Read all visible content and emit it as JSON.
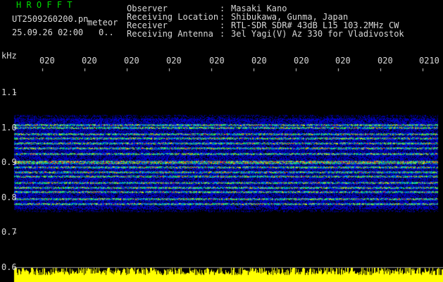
{
  "header": {
    "logo": "H R O F F T",
    "filename": "UT2509260200.pn",
    "meteor_label": "meteor",
    "date": "25.09.26 02:00",
    "count": "0.."
  },
  "info": [
    {
      "label": "Observer",
      "value": "Masaki Kano"
    },
    {
      "label": "Receiving Location",
      "value": "Shibukawa, Gunma, Japan"
    },
    {
      "label": "Receiver",
      "value": "RTL-SDR SDR# 43dB L15 103.2MHz CW"
    },
    {
      "label": "Receiving Antenna",
      "value": "3el Yagi(V) Az 330 for Vladivostok"
    }
  ],
  "axis": {
    "y_unit": "kHz",
    "y_ticks": [
      "1.1",
      "1.0",
      "0.9",
      "0.8",
      "0.7",
      "0.6"
    ],
    "x_ticks": [
      "020",
      "020",
      "020",
      "020",
      "020",
      "020",
      "020",
      "020",
      "020",
      "0210"
    ]
  },
  "colors": {
    "background": "#000000",
    "text": "#d8d8d8",
    "logo": "#00dd00",
    "noise": "#ffff00",
    "spectrogram_low": "#0000c8",
    "spectrogram_high": "#ff2000"
  }
}
